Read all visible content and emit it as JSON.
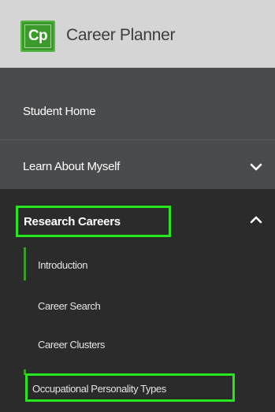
{
  "header": {
    "logo_text": "Cp",
    "title": "Career Planner"
  },
  "nav": {
    "student_home": "Student Home",
    "learn_about_myself": "Learn About Myself",
    "research_careers": "Research Careers",
    "sub_items": {
      "introduction": "Introduction",
      "career_search": "Career Search",
      "career_clusters": "Career Clusters",
      "occupational_personality_types": "Occupational Personality Types"
    }
  },
  "colors": {
    "header_bg": "#d5d5d5",
    "logo_green": "#3a9b2b",
    "nav_bg": "#4a4b4d",
    "submenu_bg": "#2b2b2c",
    "highlight": "#27e61d"
  },
  "icons": {
    "learn_chevron": "chevron-down-icon",
    "research_chevron": "chevron-up-icon"
  }
}
